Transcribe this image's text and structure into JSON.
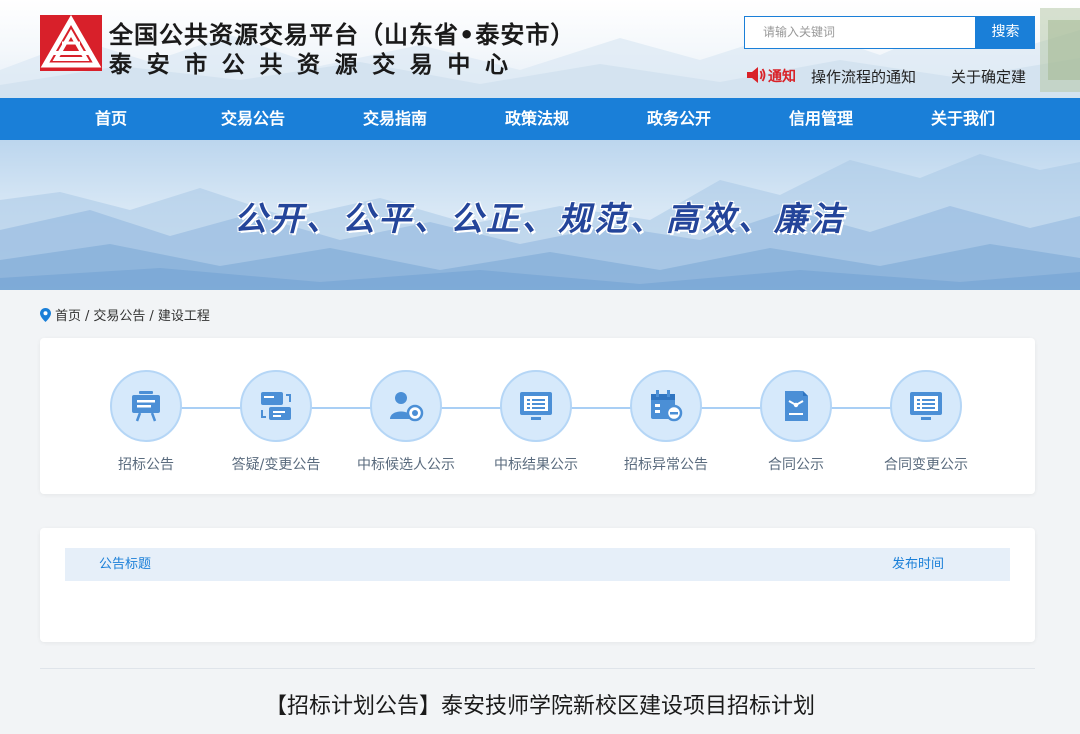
{
  "header": {
    "title": "全国公共资源交易平台（山东省•泰安市）",
    "subtitle": "泰安市公共资源交易中心",
    "search": {
      "placeholder": "请输入关键词",
      "button_label": "搜索"
    },
    "notice": {
      "label": "通知",
      "items": [
        "操作流程的通知",
        "关于确定建"
      ]
    }
  },
  "nav": {
    "items": [
      "首页",
      "交易公告",
      "交易指南",
      "政策法规",
      "政务公开",
      "信用管理",
      "关于我们"
    ]
  },
  "banner": {
    "slogan": "公开、公平、公正、规范、高效、廉洁"
  },
  "breadcrumb": {
    "items": [
      "首页",
      "交易公告",
      "建设工程"
    ],
    "separator": "/"
  },
  "process": {
    "steps": [
      {
        "label": "招标公告",
        "icon": "presentation-board-icon"
      },
      {
        "label": "答疑/变更公告",
        "icon": "exchange-cards-icon"
      },
      {
        "label": "中标候选人公示",
        "icon": "user-award-icon"
      },
      {
        "label": "中标结果公示",
        "icon": "monitor-list-icon"
      },
      {
        "label": "招标异常公告",
        "icon": "calendar-minus-icon"
      },
      {
        "label": "合同公示",
        "icon": "contract-document-icon"
      },
      {
        "label": "合同变更公示",
        "icon": "monitor-list-icon"
      }
    ]
  },
  "list": {
    "column_title": "公告标题",
    "column_date": "发布时间"
  },
  "article": {
    "title": "【招标计划公告】泰安技师学院新校区建设项目招标计划"
  },
  "colors": {
    "primary": "#1a7fd8",
    "notice_red": "#d92127",
    "slogan": "#24459a",
    "step_circle": "#d6e9fb"
  }
}
